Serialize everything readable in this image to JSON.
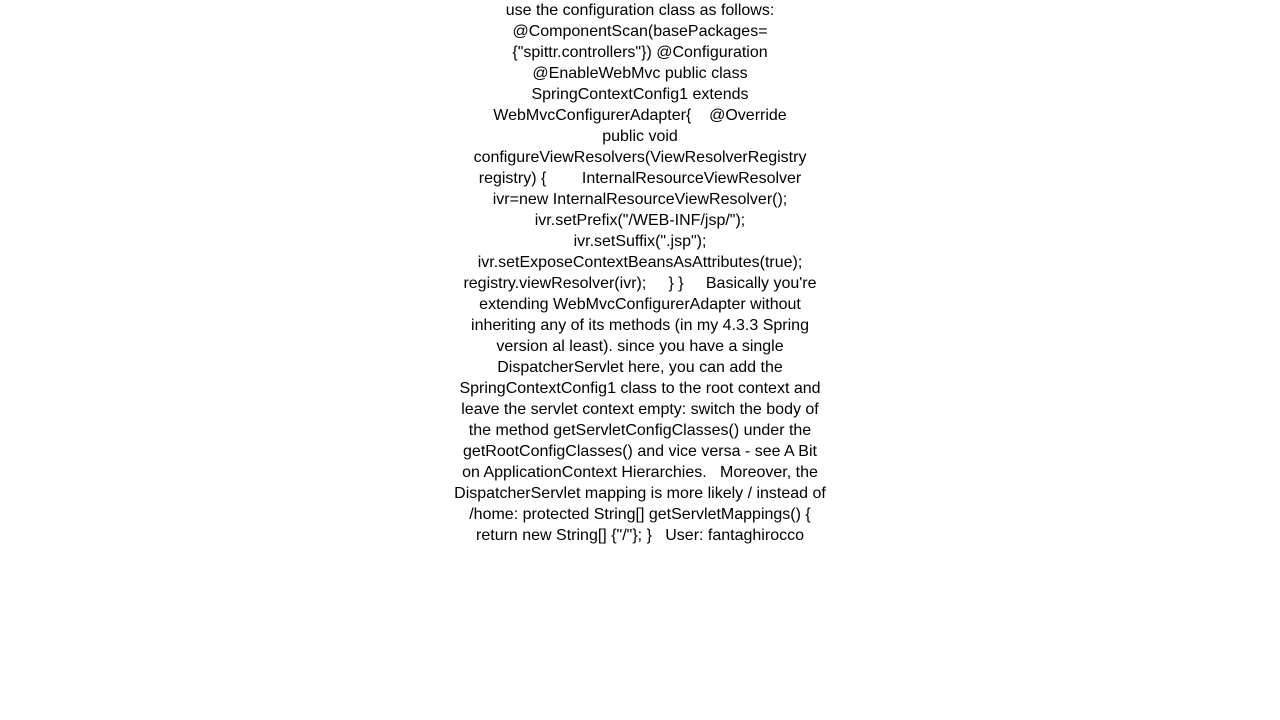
{
  "document": {
    "background_color": "#ffffff",
    "text_color": "#000000",
    "body_text": "use the configuration class as follows: @ComponentScan(basePackages={\"spittr.controllers\"}) @Configuration @EnableWebMvc public class SpringContextConfig1 extends WebMvcConfigurerAdapter{    @Override            public void configureViewResolvers(ViewResolverRegistry registry) {        InternalResourceViewResolver ivr=new InternalResourceViewResolver();        ivr.setPrefix(\"/WEB-INF/jsp/\");        ivr.setSuffix(\".jsp\");        ivr.setExposeContextBeansAsAttributes(true);        registry.viewResolver(ivr);     } }     Basically you're extending WebMvcConfigurerAdapter without inheriting any of its methods (in my 4.3.3 Spring version al least). since you have a single DispatcherServlet here, you can add the SpringContextConfig1 class to the root context and leave the servlet context empty: switch the body of the method getServletConfigClasses() under the getRootConfigClasses() and vice versa - see A Bit on ApplicationContext Hierarchies.   Moreover, the DispatcherServlet mapping is more likely / instead of /home: protected String[] getServletMappings() {    return new String[] {\"/\"}; }   User: fantaghirocco"
  }
}
